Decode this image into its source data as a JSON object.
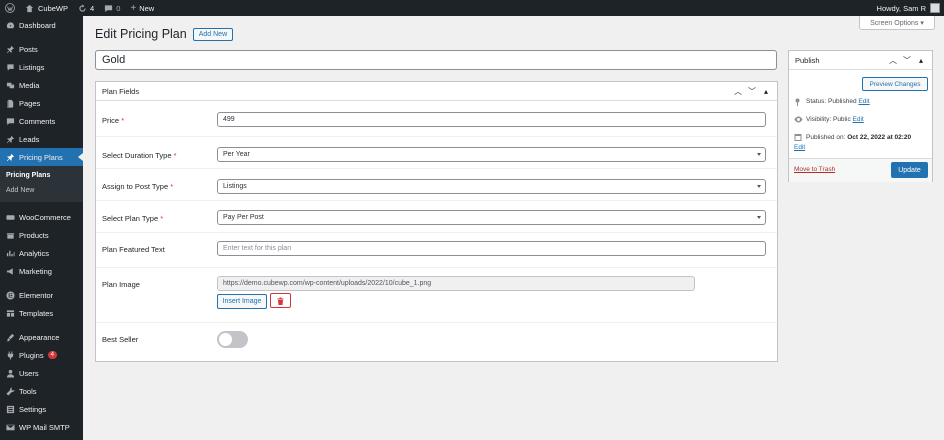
{
  "adminbar": {
    "site_name": "CubeWP",
    "updates_count": "4",
    "comments_count": "0",
    "new_label": "New",
    "howdy": "Howdy, Sam R"
  },
  "sidebar": {
    "items": [
      {
        "label": "Dashboard",
        "icon": "dashboard-icon"
      },
      {
        "label": "Posts",
        "icon": "pin-icon"
      },
      {
        "label": "Listings",
        "icon": "listings-icon"
      },
      {
        "label": "Media",
        "icon": "media-icon"
      },
      {
        "label": "Pages",
        "icon": "pages-icon"
      },
      {
        "label": "Comments",
        "icon": "comments-icon"
      },
      {
        "label": "Leads",
        "icon": "pin-icon"
      },
      {
        "label": "Pricing Plans",
        "icon": "pin-icon"
      },
      {
        "label": "WooCommerce",
        "icon": "woo-icon"
      },
      {
        "label": "Products",
        "icon": "products-icon"
      },
      {
        "label": "Analytics",
        "icon": "analytics-icon"
      },
      {
        "label": "Marketing",
        "icon": "marketing-icon"
      },
      {
        "label": "Elementor",
        "icon": "elementor-icon"
      },
      {
        "label": "Templates",
        "icon": "templates-icon"
      },
      {
        "label": "Appearance",
        "icon": "brush-icon"
      },
      {
        "label": "Plugins",
        "icon": "plug-icon",
        "badge": "4"
      },
      {
        "label": "Users",
        "icon": "users-icon"
      },
      {
        "label": "Tools",
        "icon": "wrench-icon"
      },
      {
        "label": "Settings",
        "icon": "settings-icon"
      },
      {
        "label": "WP Mail SMTP",
        "icon": "mail-icon"
      }
    ],
    "submenu": [
      "Pricing Plans",
      "Add New"
    ]
  },
  "screen_options": "Screen Options ▾",
  "heading": {
    "title": "Edit Pricing Plan",
    "add_new": "Add New"
  },
  "post_title": "Gold",
  "plan_fields": {
    "title": "Plan Fields",
    "price": {
      "label": "Price",
      "value": "499"
    },
    "duration": {
      "label": "Select Duration Type",
      "value": "Per Year"
    },
    "post_type": {
      "label": "Assign to Post Type",
      "value": "Listings"
    },
    "plan_type": {
      "label": "Select Plan Type",
      "value": "Pay Per Post"
    },
    "featured_text": {
      "label": "Plan Featured Text",
      "placeholder": "Enter text for this plan"
    },
    "image": {
      "label": "Plan Image",
      "value": "https://demo.cubewp.com/wp-content/uploads/2022/10/cube_1.png",
      "insert_label": "Insert Image"
    },
    "best_seller": {
      "label": "Best Seller",
      "value": false
    }
  },
  "publish": {
    "title": "Publish",
    "preview": "Preview Changes",
    "status_label": "Status:",
    "status_value": "Published",
    "visibility_label": "Visibility:",
    "visibility_value": "Public",
    "published_label": "Published on:",
    "published_value": "Oct 22, 2022 at 02:20",
    "edit": "Edit",
    "trash": "Move to Trash",
    "update": "Update"
  }
}
